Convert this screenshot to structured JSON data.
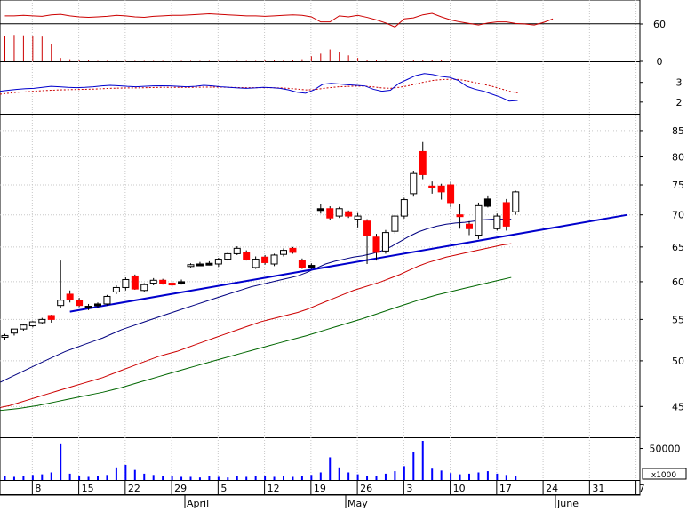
{
  "colors": {
    "up": "#ffffff",
    "down": "#ff0000",
    "neutral": "#000000",
    "ma_short": "#000080",
    "ma_mid": "#cc0000",
    "ma_long": "#006600",
    "trendline": "#0000cc",
    "volume": "#0000ff",
    "rsi": "#cc0000",
    "macd": "#0000cc",
    "macd_signal": "#cc0000",
    "grid": "#c8c8c8",
    "axis": "#000000"
  },
  "chart_data": {
    "type": "candlestick",
    "x_day_labels": [
      "8",
      "15",
      "22",
      "29",
      "5",
      "12",
      "19",
      "26",
      "3",
      "10",
      "17",
      "24",
      "31",
      "7"
    ],
    "x_month_labels": [
      "April",
      "May",
      "June"
    ],
    "price": {
      "yticks": [
        45,
        50,
        55,
        60,
        65,
        70,
        75,
        80,
        85
      ],
      "ylim": [
        42,
        88
      ],
      "scale": "log",
      "trendline": {
        "from": [
          15,
          56
        ],
        "to": [
          93,
          70
        ]
      },
      "candles": [
        {
          "o": 52.8,
          "h": 53.2,
          "l": 52.4,
          "c": 53.0,
          "k": "up"
        },
        {
          "o": 53.3,
          "h": 53.8,
          "l": 53.0,
          "c": 53.8,
          "k": "up"
        },
        {
          "o": 53.8,
          "h": 54.4,
          "l": 53.6,
          "c": 54.3,
          "k": "up"
        },
        {
          "o": 54.2,
          "h": 54.8,
          "l": 54.0,
          "c": 54.7,
          "k": "up"
        },
        {
          "o": 54.6,
          "h": 55.2,
          "l": 54.4,
          "c": 55.0,
          "k": "up"
        },
        {
          "o": 55.0,
          "h": 55.6,
          "l": 54.6,
          "c": 55.5,
          "k": "down"
        },
        {
          "o": 56.8,
          "h": 63.0,
          "l": 56.5,
          "c": 57.5,
          "k": "up"
        },
        {
          "o": 58.3,
          "h": 58.8,
          "l": 57.2,
          "c": 57.6,
          "k": "down"
        },
        {
          "o": 57.5,
          "h": 57.8,
          "l": 56.6,
          "c": 56.8,
          "k": "down"
        },
        {
          "o": 56.6,
          "h": 57.0,
          "l": 56.2,
          "c": 56.7,
          "k": "neutral"
        },
        {
          "o": 56.8,
          "h": 57.2,
          "l": 56.5,
          "c": 57.0,
          "k": "neutral"
        },
        {
          "o": 57.0,
          "h": 58.2,
          "l": 56.8,
          "c": 58.0,
          "k": "up"
        },
        {
          "o": 58.6,
          "h": 59.5,
          "l": 58.3,
          "c": 59.2,
          "k": "up"
        },
        {
          "o": 59.2,
          "h": 60.6,
          "l": 58.8,
          "c": 60.3,
          "k": "up"
        },
        {
          "o": 60.8,
          "h": 61.0,
          "l": 58.9,
          "c": 59.0,
          "k": "down"
        },
        {
          "o": 58.8,
          "h": 59.8,
          "l": 58.6,
          "c": 59.6,
          "k": "up"
        },
        {
          "o": 59.8,
          "h": 60.5,
          "l": 59.5,
          "c": 60.2,
          "k": "up"
        },
        {
          "o": 60.2,
          "h": 60.4,
          "l": 59.6,
          "c": 59.8,
          "k": "down"
        },
        {
          "o": 59.8,
          "h": 60.1,
          "l": 59.3,
          "c": 59.6,
          "k": "down"
        },
        {
          "o": 60.0,
          "h": 60.3,
          "l": 59.6,
          "c": 60.0,
          "k": "neutral"
        },
        {
          "o": 62.3,
          "h": 62.6,
          "l": 62.0,
          "c": 62.4,
          "k": "up"
        },
        {
          "o": 62.5,
          "h": 62.8,
          "l": 62.2,
          "c": 62.5,
          "k": "neutral"
        },
        {
          "o": 62.6,
          "h": 62.9,
          "l": 62.3,
          "c": 62.6,
          "k": "neutral"
        },
        {
          "o": 62.5,
          "h": 63.4,
          "l": 62.1,
          "c": 63.2,
          "k": "up"
        },
        {
          "o": 63.2,
          "h": 64.3,
          "l": 63.0,
          "c": 64.0,
          "k": "up"
        },
        {
          "o": 64.0,
          "h": 65.1,
          "l": 63.8,
          "c": 64.8,
          "k": "up"
        },
        {
          "o": 64.2,
          "h": 64.5,
          "l": 63.0,
          "c": 63.2,
          "k": "down"
        },
        {
          "o": 63.2,
          "h": 63.6,
          "l": 61.8,
          "c": 62.0,
          "k": "up"
        },
        {
          "o": 63.5,
          "h": 63.8,
          "l": 62.4,
          "c": 62.7,
          "k": "down"
        },
        {
          "o": 62.5,
          "h": 64.0,
          "l": 62.2,
          "c": 63.8,
          "k": "up"
        },
        {
          "o": 63.9,
          "h": 64.8,
          "l": 63.6,
          "c": 64.5,
          "k": "up"
        },
        {
          "o": 64.8,
          "h": 65.0,
          "l": 64.0,
          "c": 64.2,
          "k": "down"
        },
        {
          "o": 63.0,
          "h": 63.3,
          "l": 61.8,
          "c": 62.0,
          "k": "down"
        },
        {
          "o": 62.0,
          "h": 62.6,
          "l": 61.8,
          "c": 62.3,
          "k": "neutral"
        },
        {
          "o": 71.0,
          "h": 71.8,
          "l": 70.2,
          "c": 71.0,
          "k": "neutral"
        },
        {
          "o": 71.0,
          "h": 71.4,
          "l": 69.2,
          "c": 69.5,
          "k": "down"
        },
        {
          "o": 69.8,
          "h": 71.3,
          "l": 69.5,
          "c": 71.0,
          "k": "up"
        },
        {
          "o": 70.5,
          "h": 70.7,
          "l": 69.5,
          "c": 69.8,
          "k": "down"
        },
        {
          "o": 69.8,
          "h": 70.3,
          "l": 68.0,
          "c": 69.3,
          "k": "up"
        },
        {
          "o": 69.0,
          "h": 69.3,
          "l": 62.5,
          "c": 66.8,
          "k": "down"
        },
        {
          "o": 66.5,
          "h": 67.0,
          "l": 63.0,
          "c": 64.2,
          "k": "down"
        },
        {
          "o": 64.4,
          "h": 67.6,
          "l": 64.0,
          "c": 67.2,
          "k": "up"
        },
        {
          "o": 67.4,
          "h": 70.0,
          "l": 67.0,
          "c": 69.8,
          "k": "up"
        },
        {
          "o": 69.8,
          "h": 72.8,
          "l": 69.4,
          "c": 72.5,
          "k": "up"
        },
        {
          "o": 73.5,
          "h": 77.5,
          "l": 73.0,
          "c": 77.0,
          "k": "up"
        },
        {
          "o": 81.0,
          "h": 82.8,
          "l": 76.0,
          "c": 76.8,
          "k": "down"
        },
        {
          "o": 74.8,
          "h": 75.6,
          "l": 73.5,
          "c": 74.5,
          "k": "down"
        },
        {
          "o": 74.8,
          "h": 75.2,
          "l": 72.5,
          "c": 73.8,
          "k": "down"
        },
        {
          "o": 75.0,
          "h": 75.5,
          "l": 71.2,
          "c": 72.0,
          "k": "down"
        },
        {
          "o": 70.0,
          "h": 71.8,
          "l": 67.8,
          "c": 69.8,
          "k": "down"
        },
        {
          "o": 68.5,
          "h": 69.0,
          "l": 66.8,
          "c": 67.8,
          "k": "down"
        },
        {
          "o": 66.8,
          "h": 72.0,
          "l": 66.2,
          "c": 71.5,
          "k": "up"
        },
        {
          "o": 72.6,
          "h": 73.2,
          "l": 71.2,
          "c": 71.4,
          "k": "neutral"
        },
        {
          "o": 67.8,
          "h": 70.2,
          "l": 67.5,
          "c": 69.8,
          "k": "up"
        },
        {
          "o": 72.0,
          "h": 72.6,
          "l": 67.5,
          "c": 68.2,
          "k": "down"
        },
        {
          "o": 70.5,
          "h": 74.0,
          "l": 70.0,
          "c": 73.8,
          "k": "up"
        }
      ],
      "ma_short": [
        47.6,
        48.1,
        48.6,
        49.1,
        49.6,
        50.1,
        50.6,
        51.1,
        51.5,
        51.9,
        52.3,
        52.7,
        53.2,
        53.7,
        54.1,
        54.5,
        54.9,
        55.3,
        55.7,
        56.1,
        56.5,
        56.9,
        57.3,
        57.7,
        58.1,
        58.5,
        58.9,
        59.3,
        59.6,
        59.9,
        60.2,
        60.5,
        60.8,
        61.3,
        61.9,
        62.5,
        62.9,
        63.2,
        63.5,
        63.7,
        64.0,
        64.4,
        65.0,
        65.8,
        66.6,
        67.3,
        67.8,
        68.2,
        68.5,
        68.7,
        68.8,
        69.0,
        69.2,
        69.3,
        69.3,
        69.3
      ],
      "ma_mid": [
        44.9,
        45.1,
        45.4,
        45.7,
        46.0,
        46.3,
        46.6,
        46.9,
        47.2,
        47.5,
        47.8,
        48.1,
        48.5,
        48.9,
        49.3,
        49.7,
        50.1,
        50.5,
        50.8,
        51.1,
        51.5,
        51.9,
        52.3,
        52.7,
        53.1,
        53.5,
        53.9,
        54.3,
        54.7,
        55.0,
        55.3,
        55.6,
        55.9,
        56.3,
        56.8,
        57.3,
        57.8,
        58.3,
        58.8,
        59.2,
        59.6,
        60.0,
        60.5,
        61.0,
        61.6,
        62.2,
        62.7,
        63.1,
        63.5,
        63.8,
        64.1,
        64.4,
        64.7,
        65.0,
        65.3,
        65.5
      ],
      "ma_long": [
        44.6,
        44.7,
        44.8,
        44.95,
        45.1,
        45.3,
        45.5,
        45.7,
        45.9,
        46.1,
        46.3,
        46.5,
        46.75,
        47.0,
        47.3,
        47.6,
        47.9,
        48.2,
        48.5,
        48.8,
        49.1,
        49.4,
        49.7,
        50.0,
        50.3,
        50.6,
        50.9,
        51.2,
        51.5,
        51.8,
        52.1,
        52.4,
        52.7,
        53.0,
        53.35,
        53.7,
        54.05,
        54.4,
        54.75,
        55.1,
        55.5,
        55.9,
        56.3,
        56.7,
        57.1,
        57.5,
        57.85,
        58.2,
        58.5,
        58.8,
        59.1,
        59.4,
        59.7,
        60.0,
        60.3,
        60.6
      ]
    },
    "rsi": {
      "yticks": [
        60,
        0
      ],
      "ylim": [
        0,
        100
      ],
      "line": [
        88,
        88,
        89,
        88,
        87,
        90,
        91,
        88,
        86,
        85,
        86,
        87,
        89,
        88,
        86,
        85,
        87,
        88,
        89,
        89,
        90,
        91,
        92,
        91,
        90,
        89,
        88,
        88,
        87,
        88,
        89,
        90,
        89,
        86,
        76,
        76,
        88,
        86,
        89,
        85,
        80,
        74,
        66,
        82,
        84,
        90,
        93,
        86,
        80,
        76,
        73,
        70,
        74,
        76,
        76,
        73,
        72,
        70,
        75,
        82
      ],
      "bars": [
        60,
        62,
        61,
        60,
        58,
        40,
        8,
        5,
        3,
        2,
        1,
        1,
        -1,
        -1,
        -2,
        -3,
        -2,
        -3,
        -4,
        -5,
        -6,
        -5,
        -4,
        -3,
        -2,
        -1,
        0,
        1,
        2,
        2,
        3,
        4,
        5,
        12,
        18,
        28,
        22,
        14,
        8,
        4,
        2,
        1,
        0,
        1,
        2,
        2,
        3,
        4,
        5
      ]
    },
    "macd": {
      "yticks": [
        3,
        2
      ],
      "ylim": [
        1.45,
        3.8
      ],
      "macd": [
        2.55,
        2.6,
        2.65,
        2.68,
        2.7,
        2.75,
        2.8,
        2.78,
        2.75,
        2.73,
        2.75,
        2.78,
        2.82,
        2.85,
        2.83,
        2.8,
        2.78,
        2.8,
        2.82,
        2.83,
        2.82,
        2.8,
        2.78,
        2.8,
        2.85,
        2.82,
        2.78,
        2.75,
        2.72,
        2.7,
        2.72,
        2.75,
        2.73,
        2.7,
        2.62,
        2.5,
        2.45,
        2.62,
        2.9,
        2.95,
        2.92,
        2.88,
        2.85,
        2.82,
        2.65,
        2.55,
        2.6,
        2.95,
        3.15,
        3.35,
        3.45,
        3.4,
        3.3,
        3.25,
        3.1,
        2.8,
        2.65,
        2.55,
        2.4,
        2.25,
        2.05,
        2.08
      ],
      "signal": [
        2.4,
        2.45,
        2.5,
        2.52,
        2.55,
        2.58,
        2.6,
        2.62,
        2.63,
        2.64,
        2.65,
        2.66,
        2.68,
        2.7,
        2.71,
        2.72,
        2.72,
        2.73,
        2.74,
        2.75,
        2.75,
        2.75,
        2.75,
        2.75,
        2.76,
        2.76,
        2.76,
        2.75,
        2.74,
        2.73,
        2.73,
        2.73,
        2.73,
        2.72,
        2.7,
        2.66,
        2.62,
        2.63,
        2.69,
        2.74,
        2.78,
        2.8,
        2.81,
        2.81,
        2.77,
        2.72,
        2.7,
        2.75,
        2.82,
        2.92,
        3.02,
        3.1,
        3.14,
        3.16,
        3.15,
        3.08,
        2.99,
        2.9,
        2.8,
        2.68,
        2.55,
        2.47
      ]
    },
    "volume": {
      "ytick": "50000",
      "unit": "x1000",
      "max": 62000,
      "bars": [
        7000,
        5000,
        6000,
        8000,
        9000,
        12000,
        58000,
        10000,
        6000,
        5000,
        7000,
        8000,
        20000,
        24000,
        16000,
        10000,
        8000,
        7000,
        6000,
        5000,
        5000,
        4000,
        6000,
        5000,
        4000,
        6000,
        5000,
        7000,
        6000,
        5000,
        6000,
        5000,
        7000,
        8000,
        12000,
        36000,
        20000,
        12000,
        9000,
        6000,
        7000,
        10000,
        14000,
        22000,
        44000,
        62000,
        18000,
        15000,
        11000,
        9000,
        10000,
        12000,
        14000,
        10000,
        8000,
        6000
      ]
    }
  }
}
